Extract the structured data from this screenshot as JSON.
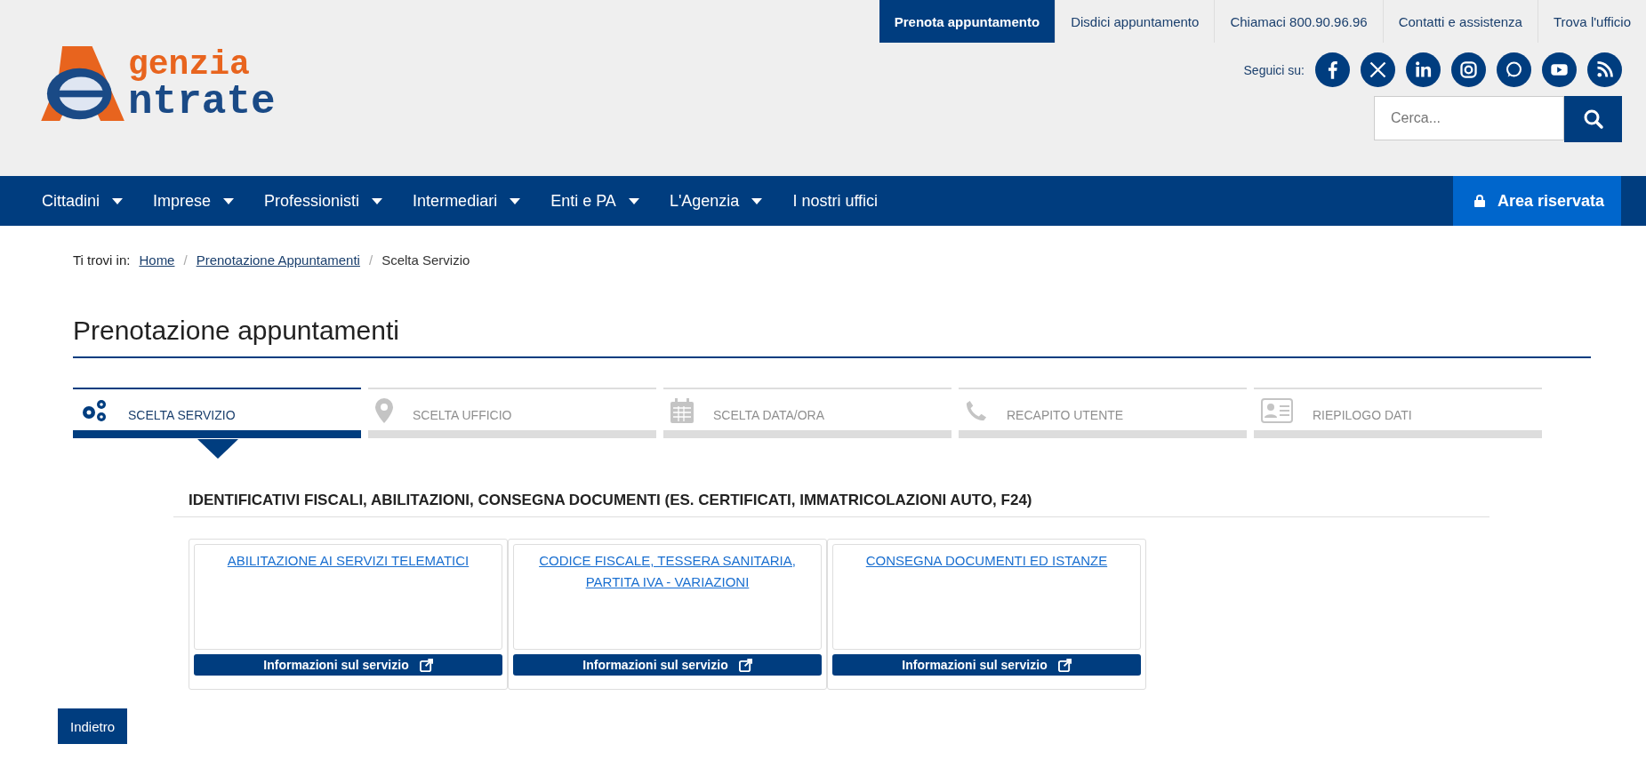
{
  "logo": {
    "line_1": "genzia",
    "line_2": "ntrate"
  },
  "top_links": [
    {
      "label": "Prenota appuntamento",
      "selected": true
    },
    {
      "label": "Disdici appuntamento",
      "selected": false
    },
    {
      "label": "Chiamaci 800.90.96.96",
      "selected": false
    },
    {
      "label": "Contatti e assistenza",
      "selected": false
    },
    {
      "label": "Trova l'ufficio",
      "selected": false
    }
  ],
  "social": {
    "label": "Seguici su:"
  },
  "search": {
    "placeholder": "Cerca..."
  },
  "nav": [
    {
      "label": "Cittadini",
      "dropdown": true
    },
    {
      "label": "Imprese",
      "dropdown": true
    },
    {
      "label": "Professionisti",
      "dropdown": true
    },
    {
      "label": "Intermediari",
      "dropdown": true
    },
    {
      "label": "Enti e PA",
      "dropdown": true
    },
    {
      "label": "L'Agenzia",
      "dropdown": true
    },
    {
      "label": "I nostri uffici",
      "dropdown": false
    }
  ],
  "reserved_area": "Area riservata",
  "breadcrumb": {
    "label": "Ti trovi in:",
    "separator": "/",
    "items": [
      {
        "label": "Home",
        "link": true
      },
      {
        "label": "Prenotazione Appuntamenti",
        "link": true
      },
      {
        "label": "Scelta Servizio",
        "link": false
      }
    ]
  },
  "title": "Prenotazione appuntamenti",
  "steps": [
    {
      "kind": "service",
      "label": "SCELTA SERVIZIO",
      "selected": true
    },
    {
      "kind": "office",
      "label": "SCELTA UFFICIO",
      "selected": false
    },
    {
      "kind": "date",
      "label": "SCELTA DATA/ORA",
      "selected": false
    },
    {
      "kind": "contact",
      "label": "RECAPITO UTENTE",
      "selected": false
    },
    {
      "kind": "summary",
      "label": "RIEPILOGO DATI",
      "selected": false
    }
  ],
  "section_title": "IDENTIFICATIVI FISCALI, ABILITAZIONI, CONSEGNA DOCUMENTI (ES. CERTIFICATI, IMMATRICOLAZIONI AUTO, F24)",
  "services": [
    {
      "title": "ABILITAZIONE AI SERVIZI TELEMATICI",
      "info": "Informazioni sul servizio"
    },
    {
      "title": "CODICE FISCALE, TESSERA SANITARIA, PARTITA IVA - VARIAZIONI",
      "info": "Informazioni sul servizio"
    },
    {
      "title": "CONSEGNA DOCUMENTI ED ISTANZE",
      "info": "Informazioni sul servizio"
    }
  ],
  "back_button": "Indietro"
}
